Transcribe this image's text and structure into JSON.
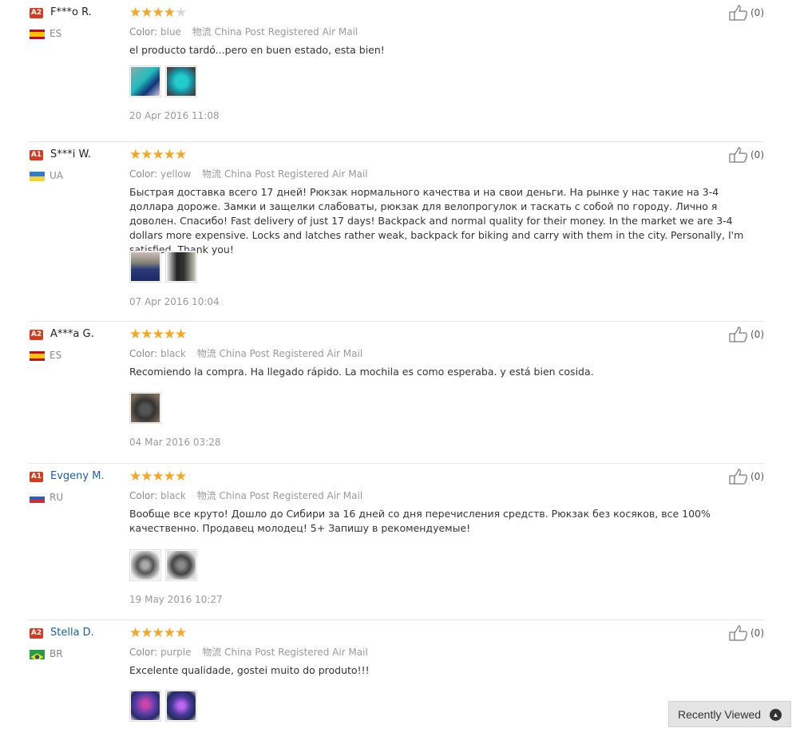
{
  "reviews": [
    {
      "level": "A2",
      "name": "F***o R.",
      "name_link": false,
      "country": "ES",
      "flag": "es",
      "stars": 4,
      "color_label": "Color:",
      "color": "blue",
      "ship_prefix": "物流",
      "shipping": "China Post Registered Air Mail",
      "text": "el producto tardó...pero en buen estado, esta bien!",
      "photos": [
        "photo-teal-backpack",
        "photo-teal-backpack"
      ],
      "date": "20 Apr 2016 11:08",
      "helpful": "(0)"
    },
    {
      "level": "A1",
      "name": "S***i W.",
      "name_link": false,
      "country": "UA",
      "flag": "ua",
      "stars": 5,
      "color_label": "Color:",
      "color": "yellow",
      "ship_prefix": "物流",
      "shipping": "China Post Registered Air Mail",
      "text": "Быстрая доставка всего 17 дней! Рюкзак нормального качества и на свои деньги. На рынке у нас такие на 3-4 доллара дороже. Замки и защелки слабоваты, рюкзак для велопрогулок и таскать с собой по городу. Лично я доволен. Спасибо! Fast delivery of just 17 days! Backpack and normal quality for their money. In the market we are 3-4 dollars more expensive. Locks and latches rather weak, backpack for biking and carry with them in the city. Personally, I'm satisfied. Thank you!",
      "photos": [
        "photo-blue-backpack",
        "photo-dark-backpack"
      ],
      "date": "07 Apr 2016 10:04",
      "helpful": "(0)"
    },
    {
      "level": "A2",
      "name": "A***a G.",
      "name_link": false,
      "country": "ES",
      "flag": "es",
      "stars": 5,
      "color_label": "Color:",
      "color": "black",
      "ship_prefix": "物流",
      "shipping": "China Post Registered Air Mail",
      "text": "Recomiendo la compra. Ha llegado rápido. La mochila es como esperaba. y está bien cosida.",
      "photos": [
        "photo-black-backpack"
      ],
      "date": "04 Mar 2016 03:28",
      "helpful": "(0)"
    },
    {
      "level": "A1",
      "name": "Evgeny M.",
      "name_link": true,
      "country": "RU",
      "flag": "ru",
      "stars": 5,
      "color_label": "Color:",
      "color": "black",
      "ship_prefix": "物流",
      "shipping": "China Post Registered Air Mail",
      "text": "Вообще все круто! Дошло до Сибири за 16 дней со дня перечисления средств. Рюкзак без косяков, все 100% качественно. Продавец молодец! 5+ Запишу в рекомендуемые!",
      "photos": [
        "photo-gray-backpack",
        "photo-gray-backpack"
      ],
      "date": "19 May 2016 10:27",
      "helpful": "(0)"
    },
    {
      "level": "A2",
      "name": "Stella D.",
      "name_link": true,
      "country": "BR",
      "flag": "br",
      "stars": 5,
      "color_label": "Color:",
      "color": "purple",
      "ship_prefix": "物流",
      "shipping": "China Post Registered Air Mail",
      "text": "Excelente qualidade, gostei muito do produto!!!",
      "photos": [
        "photo-purple-backpack",
        "photo-purple-backpack"
      ],
      "date": "",
      "helpful": "(0)"
    }
  ],
  "recently_viewed": {
    "label": "Recently Viewed",
    "icon": "chevron-up-icon"
  },
  "colors": {
    "badge": "#d63b1f",
    "star": "#f5a623",
    "name_link": "#1a5fa5"
  }
}
